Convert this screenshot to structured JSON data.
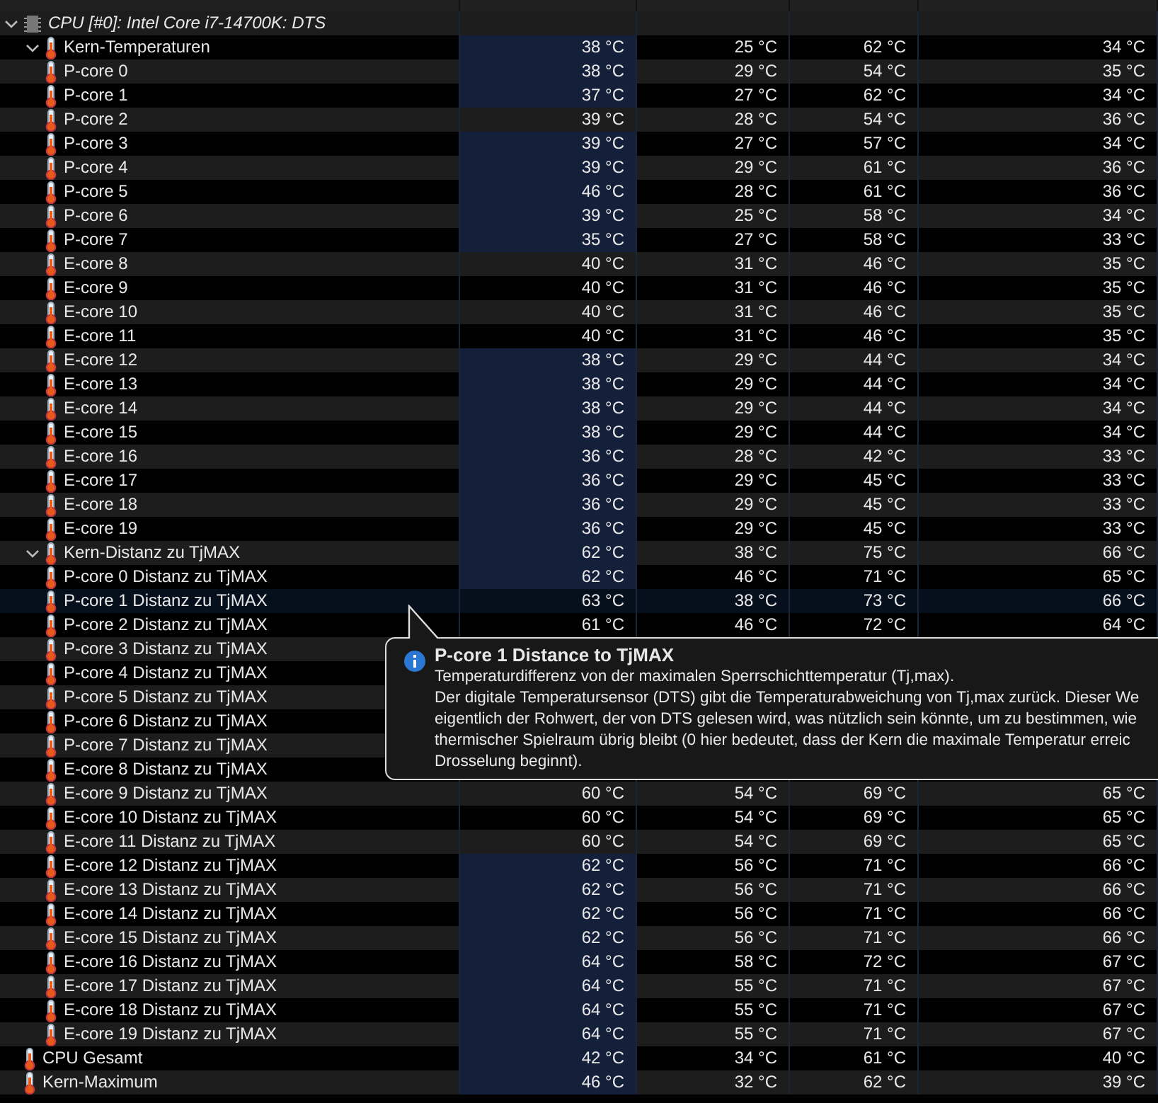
{
  "sensor_tree": [
    {
      "label": "CPU [#0]: Intel Core i7-14700K: DTS",
      "kind": "device",
      "expanded": true,
      "selected": false,
      "highlighted": false,
      "children": [
        {
          "label": "Kern-Temperaturen",
          "kind": "sensor",
          "expanded": true,
          "selected": false,
          "highlighted": true,
          "values": [
            "38 °C",
            "25 °C",
            "62 °C",
            "34 °C"
          ],
          "children": [
            {
              "label": "P-core 0",
              "kind": "sensor",
              "selected": false,
              "highlighted": true,
              "values": [
                "38 °C",
                "29 °C",
                "54 °C",
                "35 °C"
              ]
            },
            {
              "label": "P-core 1",
              "kind": "sensor",
              "selected": false,
              "highlighted": true,
              "values": [
                "37 °C",
                "27 °C",
                "62 °C",
                "34 °C"
              ]
            },
            {
              "label": "P-core 2",
              "kind": "sensor",
              "selected": false,
              "highlighted": false,
              "values": [
                "39 °C",
                "28 °C",
                "54 °C",
                "36 °C"
              ]
            },
            {
              "label": "P-core 3",
              "kind": "sensor",
              "selected": false,
              "highlighted": true,
              "values": [
                "39 °C",
                "27 °C",
                "57 °C",
                "34 °C"
              ]
            },
            {
              "label": "P-core 4",
              "kind": "sensor",
              "selected": false,
              "highlighted": true,
              "values": [
                "39 °C",
                "29 °C",
                "61 °C",
                "36 °C"
              ]
            },
            {
              "label": "P-core 5",
              "kind": "sensor",
              "selected": false,
              "highlighted": true,
              "values": [
                "46 °C",
                "28 °C",
                "61 °C",
                "36 °C"
              ]
            },
            {
              "label": "P-core 6",
              "kind": "sensor",
              "selected": false,
              "highlighted": true,
              "values": [
                "39 °C",
                "25 °C",
                "58 °C",
                "34 °C"
              ]
            },
            {
              "label": "P-core 7",
              "kind": "sensor",
              "selected": false,
              "highlighted": true,
              "values": [
                "35 °C",
                "27 °C",
                "58 °C",
                "33 °C"
              ]
            },
            {
              "label": "E-core 8",
              "kind": "sensor",
              "selected": false,
              "highlighted": false,
              "values": [
                "40 °C",
                "31 °C",
                "46 °C",
                "35 °C"
              ]
            },
            {
              "label": "E-core 9",
              "kind": "sensor",
              "selected": false,
              "highlighted": false,
              "values": [
                "40 °C",
                "31 °C",
                "46 °C",
                "35 °C"
              ]
            },
            {
              "label": "E-core 10",
              "kind": "sensor",
              "selected": false,
              "highlighted": false,
              "values": [
                "40 °C",
                "31 °C",
                "46 °C",
                "35 °C"
              ]
            },
            {
              "label": "E-core 11",
              "kind": "sensor",
              "selected": false,
              "highlighted": false,
              "values": [
                "40 °C",
                "31 °C",
                "46 °C",
                "35 °C"
              ]
            },
            {
              "label": "E-core 12",
              "kind": "sensor",
              "selected": false,
              "highlighted": true,
              "values": [
                "38 °C",
                "29 °C",
                "44 °C",
                "34 °C"
              ]
            },
            {
              "label": "E-core 13",
              "kind": "sensor",
              "selected": false,
              "highlighted": true,
              "values": [
                "38 °C",
                "29 °C",
                "44 °C",
                "34 °C"
              ]
            },
            {
              "label": "E-core 14",
              "kind": "sensor",
              "selected": false,
              "highlighted": true,
              "values": [
                "38 °C",
                "29 °C",
                "44 °C",
                "34 °C"
              ]
            },
            {
              "label": "E-core 15",
              "kind": "sensor",
              "selected": false,
              "highlighted": true,
              "values": [
                "38 °C",
                "29 °C",
                "44 °C",
                "34 °C"
              ]
            },
            {
              "label": "E-core 16",
              "kind": "sensor",
              "selected": false,
              "highlighted": true,
              "values": [
                "36 °C",
                "28 °C",
                "42 °C",
                "33 °C"
              ]
            },
            {
              "label": "E-core 17",
              "kind": "sensor",
              "selected": false,
              "highlighted": true,
              "values": [
                "36 °C",
                "29 °C",
                "45 °C",
                "33 °C"
              ]
            },
            {
              "label": "E-core 18",
              "kind": "sensor",
              "selected": false,
              "highlighted": true,
              "values": [
                "36 °C",
                "29 °C",
                "45 °C",
                "33 °C"
              ]
            },
            {
              "label": "E-core 19",
              "kind": "sensor",
              "selected": false,
              "highlighted": true,
              "values": [
                "36 °C",
                "29 °C",
                "45 °C",
                "33 °C"
              ]
            }
          ]
        },
        {
          "label": "Kern-Distanz zu TjMAX",
          "kind": "sensor",
          "expanded": true,
          "selected": false,
          "highlighted": true,
          "values": [
            "62 °C",
            "38 °C",
            "75 °C",
            "66 °C"
          ],
          "children": [
            {
              "label": "P-core 0 Distanz zu TjMAX",
              "kind": "sensor",
              "selected": false,
              "highlighted": true,
              "values": [
                "62 °C",
                "46 °C",
                "71 °C",
                "65 °C"
              ]
            },
            {
              "label": "P-core 1 Distanz zu TjMAX",
              "kind": "sensor",
              "selected": true,
              "highlighted": false,
              "values": [
                "63 °C",
                "38 °C",
                "73 °C",
                "66 °C"
              ]
            },
            {
              "label": "P-core 2 Distanz zu TjMAX",
              "kind": "sensor",
              "selected": false,
              "highlighted": false,
              "values": [
                "61 °C",
                "46 °C",
                "72 °C",
                "64 °C"
              ]
            },
            {
              "label": "P-core 3 Distanz zu TjMAX",
              "kind": "sensor",
              "selected": false
            },
            {
              "label": "P-core 4 Distanz zu TjMAX",
              "kind": "sensor",
              "selected": false
            },
            {
              "label": "P-core 5 Distanz zu TjMAX",
              "kind": "sensor",
              "selected": false
            },
            {
              "label": "P-core 6 Distanz zu TjMAX",
              "kind": "sensor",
              "selected": false
            },
            {
              "label": "P-core 7 Distanz zu TjMAX",
              "kind": "sensor",
              "selected": false
            },
            {
              "label": "E-core 8 Distanz zu TjMAX",
              "kind": "sensor",
              "selected": false
            },
            {
              "label": "E-core 9 Distanz zu TjMAX",
              "kind": "sensor",
              "selected": false,
              "highlighted": false,
              "values": [
                "60 °C",
                "54 °C",
                "69 °C",
                "65 °C"
              ]
            },
            {
              "label": "E-core 10 Distanz zu TjMAX",
              "kind": "sensor",
              "selected": false,
              "highlighted": false,
              "values": [
                "60 °C",
                "54 °C",
                "69 °C",
                "65 °C"
              ]
            },
            {
              "label": "E-core 11 Distanz zu TjMAX",
              "kind": "sensor",
              "selected": false,
              "highlighted": false,
              "values": [
                "60 °C",
                "54 °C",
                "69 °C",
                "65 °C"
              ]
            },
            {
              "label": "E-core 12 Distanz zu TjMAX",
              "kind": "sensor",
              "selected": false,
              "highlighted": true,
              "values": [
                "62 °C",
                "56 °C",
                "71 °C",
                "66 °C"
              ]
            },
            {
              "label": "E-core 13 Distanz zu TjMAX",
              "kind": "sensor",
              "selected": false,
              "highlighted": true,
              "values": [
                "62 °C",
                "56 °C",
                "71 °C",
                "66 °C"
              ]
            },
            {
              "label": "E-core 14 Distanz zu TjMAX",
              "kind": "sensor",
              "selected": false,
              "highlighted": true,
              "values": [
                "62 °C",
                "56 °C",
                "71 °C",
                "66 °C"
              ]
            },
            {
              "label": "E-core 15 Distanz zu TjMAX",
              "kind": "sensor",
              "selected": false,
              "highlighted": true,
              "values": [
                "62 °C",
                "56 °C",
                "71 °C",
                "66 °C"
              ]
            },
            {
              "label": "E-core 16 Distanz zu TjMAX",
              "kind": "sensor",
              "selected": false,
              "highlighted": true,
              "values": [
                "64 °C",
                "58 °C",
                "72 °C",
                "67 °C"
              ]
            },
            {
              "label": "E-core 17 Distanz zu TjMAX",
              "kind": "sensor",
              "selected": false,
              "highlighted": true,
              "values": [
                "64 °C",
                "55 °C",
                "71 °C",
                "67 °C"
              ]
            },
            {
              "label": "E-core 18 Distanz zu TjMAX",
              "kind": "sensor",
              "selected": false,
              "highlighted": true,
              "values": [
                "64 °C",
                "55 °C",
                "71 °C",
                "67 °C"
              ]
            },
            {
              "label": "E-core 19 Distanz zu TjMAX",
              "kind": "sensor",
              "selected": false,
              "highlighted": true,
              "values": [
                "64 °C",
                "55 °C",
                "71 °C",
                "67 °C"
              ]
            }
          ]
        },
        {
          "label": "CPU Gesamt",
          "kind": "sensor",
          "selected": false,
          "highlighted": true,
          "values": [
            "42 °C",
            "34 °C",
            "61 °C",
            "40 °C"
          ]
        },
        {
          "label": "Kern-Maximum",
          "kind": "sensor",
          "selected": false,
          "highlighted": true,
          "values": [
            "46 °C",
            "32 °C",
            "62 °C",
            "39 °C"
          ]
        }
      ]
    }
  ],
  "tooltip": {
    "title": "P-core 1 Distance to TjMAX",
    "text": "Temperaturdifferenz von der maximalen Sperrschichttemperatur (Tj,max).\nDer digitale Temperatursensor (DTS) gibt die Temperaturabweichung von Tj,max zurück. Dieser We\neigentlich der Rohwert, der von DTS gelesen wird, was nützlich sein könnte, um zu bestimmen, wie\nthermischer Spielraum übrig bleibt (0 hier bedeutet, dass der Kern die maximale Temperatur erreic\nDrosselung beginnt)."
  }
}
